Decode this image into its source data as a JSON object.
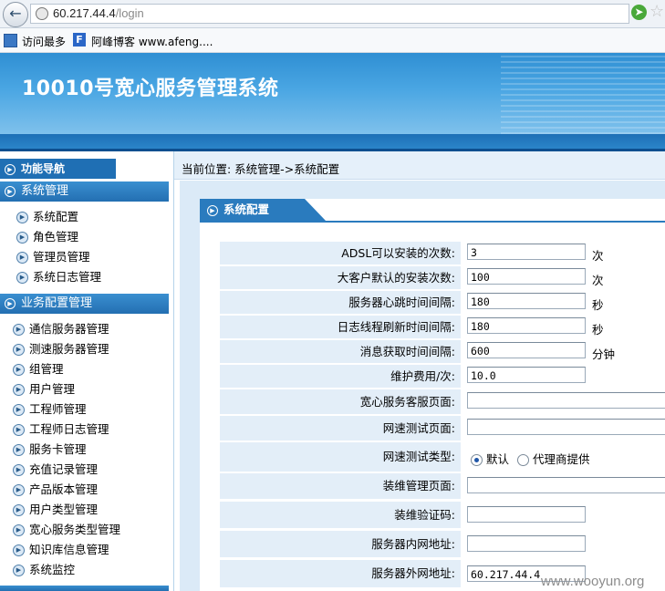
{
  "browser": {
    "url_host": "60.217.44.4",
    "url_path": "/login",
    "bookmarks": [
      {
        "label": "访问最多"
      },
      {
        "label": "阿峰博客 www.afeng...."
      }
    ]
  },
  "header": {
    "title": "10010号宽心服务管理系统"
  },
  "sidebar": {
    "nav_title": "功能导航",
    "groups": [
      {
        "title": "系统管理",
        "items": [
          "系统配置",
          "角色管理",
          "管理员管理",
          "系统日志管理"
        ]
      },
      {
        "title": "业务配置管理",
        "items": [
          "通信服务器管理",
          "测速服务器管理",
          "组管理",
          "用户管理",
          "工程师管理",
          "工程师日志管理",
          "服务卡管理",
          "充值记录管理",
          "产品版本管理",
          "用户类型管理",
          "宽心服务类型管理",
          "知识库信息管理",
          "系统监控"
        ]
      }
    ]
  },
  "breadcrumb": "当前位置: 系统管理->系统配置",
  "panel": {
    "title": "系统配置",
    "rows": [
      {
        "label": "ADSL可以安装的次数:",
        "value": "3",
        "unit": "次"
      },
      {
        "label": "大客户默认的安装次数:",
        "value": "100",
        "unit": "次"
      },
      {
        "label": "服务器心跳时间间隔:",
        "value": "180",
        "unit": "秒"
      },
      {
        "label": "日志线程刷新时间间隔:",
        "value": "180",
        "unit": "秒"
      },
      {
        "label": "消息获取时间间隔:",
        "value": "600",
        "unit": "分钟"
      },
      {
        "label": "维护费用/次:",
        "value": "10.0",
        "unit": ""
      },
      {
        "label": "宽心服务客服页面:",
        "value": "",
        "unit": ""
      },
      {
        "label": "网速测试页面:",
        "value": "",
        "unit": ""
      },
      {
        "label": "网速测试类型:",
        "options": [
          "默认",
          "代理商提供"
        ],
        "selected": "默认"
      },
      {
        "label": "装维管理页面:",
        "value": "",
        "unit": ""
      },
      {
        "label": "装维验证码:",
        "value": "",
        "unit": ""
      },
      {
        "label": "服务器内网地址:",
        "value": "",
        "unit": ""
      },
      {
        "label": "服务器外网地址:",
        "value": "60.217.44.4",
        "unit": ""
      }
    ]
  },
  "watermark": "www.wooyun.org"
}
